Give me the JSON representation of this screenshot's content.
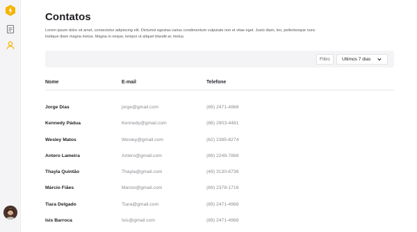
{
  "app": {
    "accent_color": "#f4b400",
    "nav_icons": [
      "bolt-logo",
      "document-icon",
      "user-icon"
    ]
  },
  "page": {
    "title": "Contatos",
    "description": "Lorem ipsum dolor sit amet, consectetur adipiscing elit. Dictumst egestas varius condimentum vulputate non et vitae eget. Justo diam, leo, pellentesque nunc tristique diam magna metus. Magna in neque, tempor ut aliquet blandit ac metus."
  },
  "filters": {
    "filter_label": "Filtro",
    "period_selected": "Ultimos 7 dias"
  },
  "table": {
    "columns": [
      "Nome",
      "E-mail",
      "Telefone"
    ],
    "rows": [
      {
        "name": "Jorge Dias",
        "email": "jorge@gmail.com",
        "phone": "(89) 2471-4968"
      },
      {
        "name": "Kennedy Pádua",
        "email": "Kennedy@gmail.com",
        "phone": "(88) 2903-4481"
      },
      {
        "name": "Wesley Matos",
        "email": "Wesley@gmail.com",
        "phone": "(62) 2385-8274"
      },
      {
        "name": "Antero Lameira",
        "email": "Antero@gmail.com",
        "phone": "(89) 2248-7888"
      },
      {
        "name": "Thayla Quintão",
        "email": "Thayla@gmail.com",
        "phone": "(49) 3130-6736"
      },
      {
        "name": "Márcio Fiães",
        "email": "Marcio@gmail.com",
        "phone": "(69) 2378-1716"
      },
      {
        "name": "Tiara Delgado",
        "email": "Tiara@gmail.com",
        "phone": "(89) 2471-4968"
      },
      {
        "name": "Isis Barroca",
        "email": "Isis@gmail.com",
        "phone": "(89) 2471-4968"
      }
    ]
  }
}
